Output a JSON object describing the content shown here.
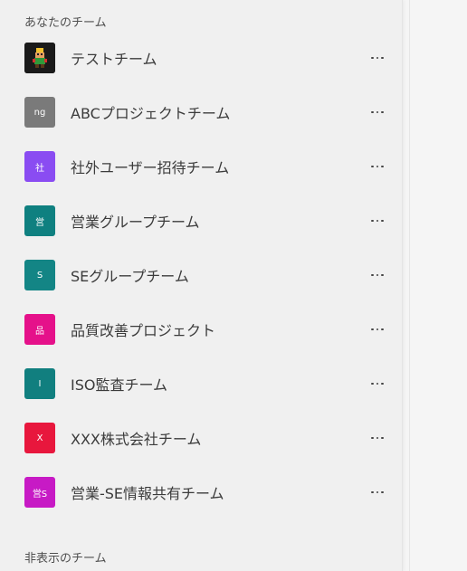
{
  "sections": {
    "your_teams_title": "あなたのチーム",
    "hidden_teams_title": "非表示のチーム"
  },
  "teams": [
    {
      "name": "テストチーム",
      "avatar_text": "",
      "avatar_color": "#1a1a1a",
      "avatar_icon": "pixel-character-icon"
    },
    {
      "name": "ABCプロジェクトチーム",
      "avatar_text": "ng",
      "avatar_color": "#7a7a7a"
    },
    {
      "name": "社外ユーザー招待チーム",
      "avatar_text": "社",
      "avatar_color": "#8a4cf2"
    },
    {
      "name": "営業グループチーム",
      "avatar_text": "営",
      "avatar_color": "#0f8080"
    },
    {
      "name": "SEグループチーム",
      "avatar_text": "S",
      "avatar_color": "#138585"
    },
    {
      "name": "品質改善プロジェクト",
      "avatar_text": "品",
      "avatar_color": "#e5118a"
    },
    {
      "name": "ISO監査チーム",
      "avatar_text": "I",
      "avatar_color": "#117f7f"
    },
    {
      "name": "XXX株式会社チーム",
      "avatar_text": "X",
      "avatar_color": "#e8173d"
    },
    {
      "name": "営業-SE情報共有チーム",
      "avatar_text": "営S",
      "avatar_color": "#c71ac5"
    }
  ],
  "more_options_icon": "more-horizontal-icon"
}
